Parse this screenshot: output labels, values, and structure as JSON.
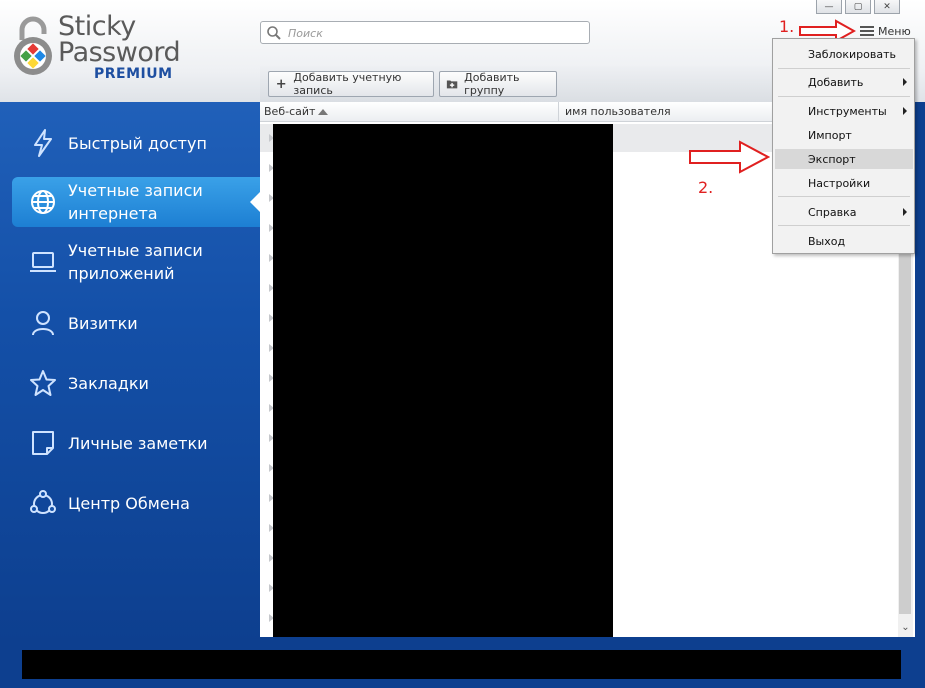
{
  "logo": {
    "line1": "Sticky",
    "line2": "Password",
    "line3": "PREMIUM"
  },
  "search": {
    "placeholder": "Поиск"
  },
  "header": {
    "menu_label": "Меню",
    "step1": "1.",
    "step2": "2."
  },
  "toolbar": {
    "add_account": "Добавить учетную запись",
    "add_group": "Добавить группу"
  },
  "table": {
    "col_site": "Веб-сайт",
    "col_user": "имя пользователя"
  },
  "sidebar": {
    "items": [
      {
        "label": "Быстрый доступ",
        "icon": "lightning-icon"
      },
      {
        "label": "Учетные записи интернета",
        "icon": "globe-icon",
        "active": true
      },
      {
        "label": "Учетные записи приложений",
        "icon": "laptop-icon"
      },
      {
        "label": "Визитки",
        "icon": "person-icon"
      },
      {
        "label": "Закладки",
        "icon": "star-icon"
      },
      {
        "label": "Личные заметки",
        "icon": "note-icon"
      },
      {
        "label": "Центр Обмена",
        "icon": "share-icon"
      }
    ]
  },
  "menu": {
    "items": [
      {
        "label": "Заблокировать"
      },
      {
        "label": "Добавить",
        "submenu": true
      },
      {
        "label": "Инструменты",
        "submenu": true
      },
      {
        "label": "Импорт"
      },
      {
        "label": "Экспорт",
        "highlighted": true
      },
      {
        "label": "Настройки"
      },
      {
        "label": "Справка",
        "submenu": true
      },
      {
        "label": "Выход"
      }
    ]
  },
  "colors": {
    "sidebar": "#1450a8",
    "active": "#2a8fe0",
    "annotation": "#e02020"
  }
}
